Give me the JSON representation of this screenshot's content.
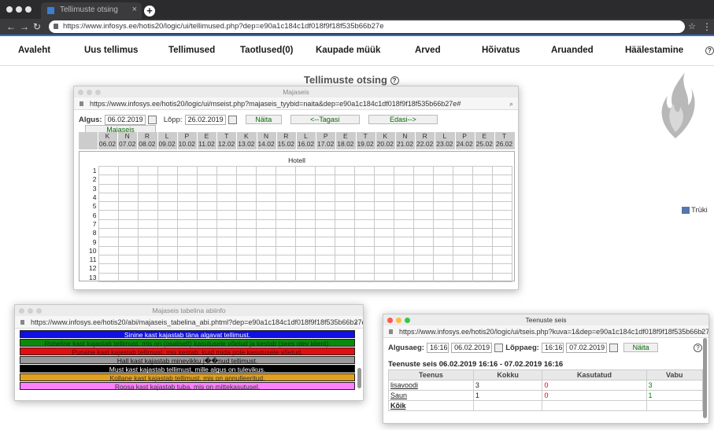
{
  "browser": {
    "tab_title": "Tellimuste otsing",
    "url": "https://www.infosys.ee/hotis20/logic/ui/tellimused.php?dep=e90a1c184c1df018f9f18f535b66b27e"
  },
  "menu": {
    "items": [
      "Avaleht",
      "Uus tellimus",
      "Tellimused",
      "Taotlused(0)",
      "Kaupade müük",
      "Arved",
      "Hõivatus",
      "Aruanded",
      "Häälestamine"
    ],
    "help": "?"
  },
  "page": {
    "title": "Tellimuste otsing",
    "print_label": "Trüki"
  },
  "majaseis": {
    "window_title": "Majaseis",
    "url": "https://www.infosys.ee/hotis20/logic/ui/mseist.php?majaseis_tyybid=naita&dep=e90a1c184c1df018f9f18f535b66b27e#",
    "algus_label": "Algus:",
    "algus_value": "06.02.2019",
    "lopp_label": "Lõpp:",
    "lopp_value": "26.02.2019",
    "naita": "Näita",
    "tagasi": "<--Tagasi",
    "edasi": "Edasi-->",
    "numbritena": "Majaseis numbritena",
    "days": [
      [
        "K",
        "06.02"
      ],
      [
        "N",
        "07.02"
      ],
      [
        "R",
        "08.02"
      ],
      [
        "L",
        "09.02"
      ],
      [
        "P",
        "10.02"
      ],
      [
        "E",
        "11.02"
      ],
      [
        "T",
        "12.02"
      ],
      [
        "K",
        "13.02"
      ],
      [
        "N",
        "14.02"
      ],
      [
        "R",
        "15.02"
      ],
      [
        "L",
        "16.02"
      ],
      [
        "P",
        "17.02"
      ],
      [
        "E",
        "18.02"
      ],
      [
        "T",
        "19.02"
      ],
      [
        "K",
        "20.02"
      ],
      [
        "N",
        "21.02"
      ],
      [
        "R",
        "22.02"
      ],
      [
        "L",
        "23.02"
      ],
      [
        "P",
        "24.02"
      ],
      [
        "E",
        "25.02"
      ],
      [
        "T",
        "26.02"
      ]
    ],
    "hotel_label": "Hotell",
    "rooms": [
      "1",
      "2",
      "3",
      "4",
      "5",
      "6",
      "7",
      "8",
      "9",
      "10",
      "11",
      "12",
      "13"
    ]
  },
  "abiinfo": {
    "window_title": "Majaseis tabelina abiinfo",
    "url": "https://www.infosys.ee/hotis20/abi/majaseis_tabelina_abi.phtml?dep=e90a1c184c1df018f9f18f535b66b27e",
    "items": [
      {
        "text": "Sinine kast kajastab täna algavat tellimust.",
        "bg": "#1010e0",
        "fg": "#ffffff"
      },
      {
        "text": "Roheline kast kajastab tellimust, mis on (osaliselt) kasutusele võetud ja kestab (sees olev klient).",
        "bg": "#0a8a0a",
        "fg": "#0c3a0c"
      },
      {
        "text": "Punane kast kajastab tellimust, mis kestab, kuid mida pole kasutusele võetud.",
        "bg": "#e01010",
        "fg": "#5a0a0a"
      },
      {
        "text": "Hall kast kajastab minevikku j��nud tellimust.",
        "bg": "#9a9a9a",
        "fg": "#111111"
      },
      {
        "text": "Must kast kajastab tellimust, mille algus on tulevikus.",
        "bg": "#000000",
        "fg": "#ffffff"
      },
      {
        "text": "Kollane kast kajastab tellimust, mis on annulleeritud.",
        "bg": "#e0a020",
        "fg": "#333333"
      },
      {
        "text": "Roosa kast kajastab tuba, mis on mittekasutusel.",
        "bg": "#ff80ff",
        "fg": "#333333"
      }
    ]
  },
  "teenuste": {
    "window_title": "Teenuste seis",
    "url": "https://www.infosys.ee/hotis20/logic/ui/tseis.php?kuva=1&dep=e90a1c184c1df018f9f18f535b66b27e",
    "algusaeg_label": "Algusaeg:",
    "algus_time": "16:16",
    "algus_date": "06.02.2019",
    "loppaeg_label": "Lõppaeg:",
    "lopp_time": "16:16",
    "lopp_date": "07.02.2019",
    "naita": "Näita",
    "heading": "Teenuste seis 06.02.2019 16:16 - 07.02.2019 16:16",
    "columns": [
      "Teenus",
      "Kokku",
      "Kasutatud",
      "Vabu"
    ],
    "rows": [
      [
        "lisavoodi",
        "3",
        "0",
        "3"
      ],
      [
        "Saun",
        "1",
        "0",
        "1"
      ]
    ],
    "total_label": "Kõik"
  }
}
